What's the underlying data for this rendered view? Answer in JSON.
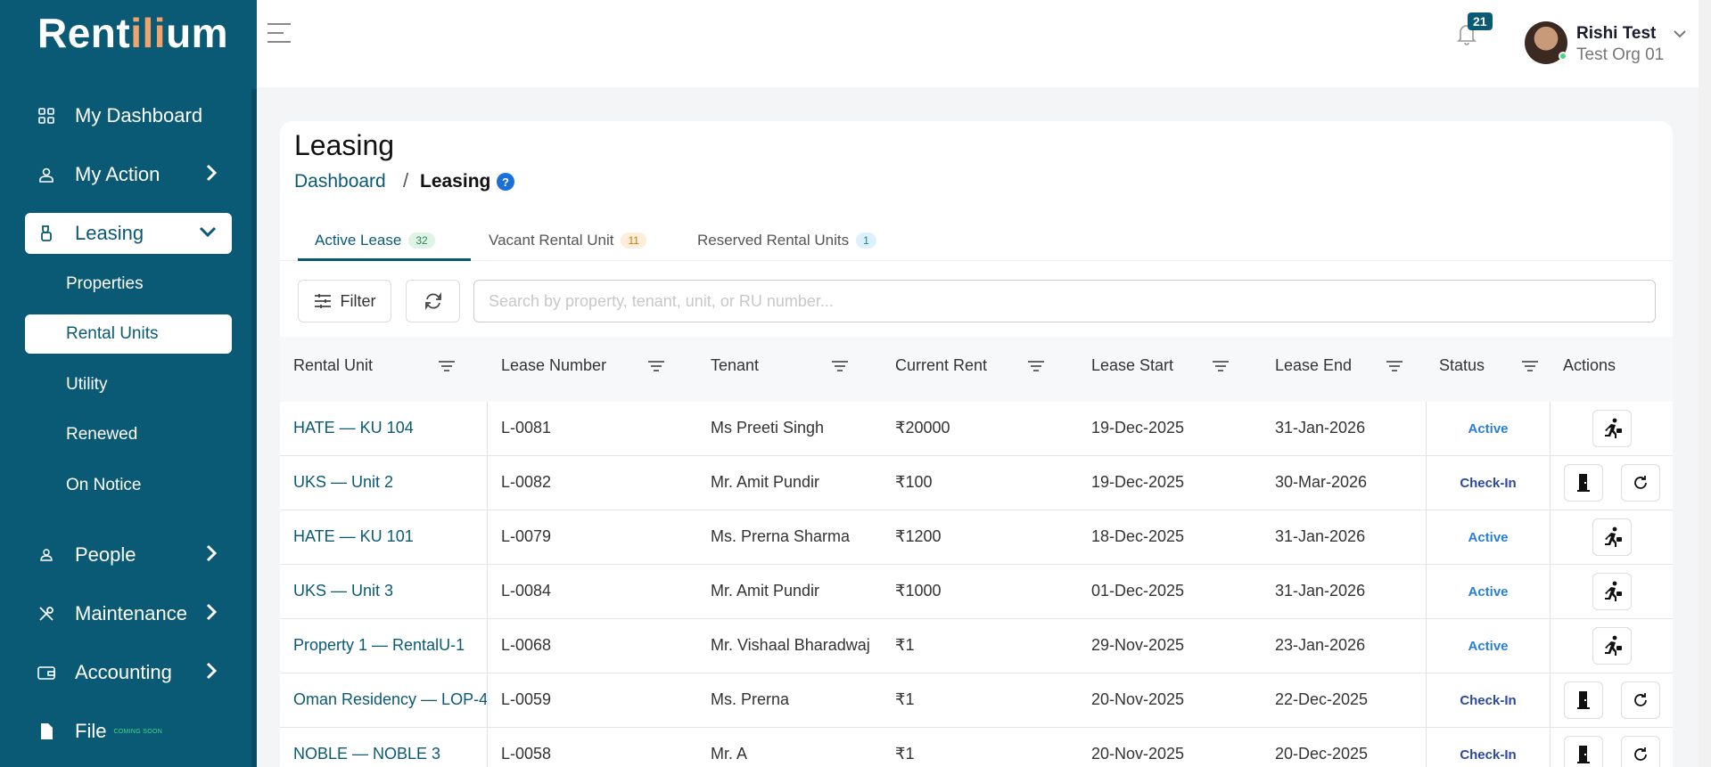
{
  "brand": {
    "logo_pre": "Rent",
    "logo_accent": "ili",
    "logo_post": "um"
  },
  "sidebar": {
    "items": [
      {
        "label": "My Dashboard",
        "icon": "grid-icon"
      },
      {
        "label": "My Action",
        "icon": "user-action-icon"
      },
      {
        "label": "Leasing",
        "icon": "lease-icon"
      },
      {
        "label": "People",
        "icon": "person-icon"
      },
      {
        "label": "Maintenance",
        "icon": "tools-icon"
      },
      {
        "label": "Accounting",
        "icon": "wallet-icon"
      },
      {
        "label": "File",
        "icon": "file-icon",
        "tag": "COMING SOON"
      }
    ],
    "leasing_sub": [
      "Properties",
      "Rental Units",
      "Utility",
      "Renewed",
      "On Notice"
    ]
  },
  "header": {
    "notifications": "21",
    "user_name": "Rishi Test",
    "user_org": "Test Org 01"
  },
  "page": {
    "title": "Leasing",
    "breadcrumb_root": "Dashboard",
    "breadcrumb_sep": "/",
    "breadcrumb_current": "Leasing",
    "help": "?"
  },
  "tabs": [
    {
      "label": "Active Lease",
      "count": "32",
      "badge_bg": "#dff3e6",
      "badge_fg": "#2b8a4f"
    },
    {
      "label": "Vacant Rental Unit",
      "count": "11",
      "badge_bg": "#fdeed9",
      "badge_fg": "#c9780c"
    },
    {
      "label": "Reserved Rental Units",
      "count": "1",
      "badge_bg": "#dcf1fb",
      "badge_fg": "#1d7fb0"
    }
  ],
  "toolbar": {
    "filter_label": "Filter",
    "search_placeholder": "Search by property, tenant, unit, or RU number..."
  },
  "table": {
    "columns": [
      "Rental Unit",
      "Lease Number",
      "Tenant",
      "Current Rent",
      "Lease Start",
      "Lease End",
      "Status",
      "Actions"
    ],
    "rows": [
      {
        "unit": "HATE — KU 104",
        "lease": "L-0081",
        "tenant": "Ms Preeti Singh",
        "rent": "₹20000",
        "start": "19-Dec-2025",
        "end": "31-Jan-2026",
        "status": "Active",
        "actions": [
          "move-out"
        ]
      },
      {
        "unit": "UKS — Unit 2",
        "lease": "L-0082",
        "tenant": "Mr. Amit Pundir",
        "rent": "₹100",
        "start": "19-Dec-2025",
        "end": "30-Mar-2026",
        "status": "Check-In",
        "actions": [
          "door",
          "refresh"
        ]
      },
      {
        "unit": "HATE — KU 101",
        "lease": "L-0079",
        "tenant": "Ms. Prerna Sharma",
        "rent": "₹1200",
        "start": "18-Dec-2025",
        "end": "31-Jan-2026",
        "status": "Active",
        "actions": [
          "move-out"
        ]
      },
      {
        "unit": "UKS — Unit 3",
        "lease": "L-0084",
        "tenant": "Mr. Amit Pundir",
        "rent": "₹1000",
        "start": "01-Dec-2025",
        "end": "31-Jan-2026",
        "status": "Active",
        "actions": [
          "move-out"
        ]
      },
      {
        "unit": "Property 1 — RentalU-1",
        "lease": "L-0068",
        "tenant": "Mr. Vishaal Bharadwaj",
        "rent": "₹1",
        "start": "29-Nov-2025",
        "end": "23-Jan-2026",
        "status": "Active",
        "actions": [
          "move-out"
        ]
      },
      {
        "unit": "Oman Residency — LOP-4",
        "lease": "L-0059",
        "tenant": "Ms. Prerna",
        "rent": "₹1",
        "start": "20-Nov-2025",
        "end": "22-Dec-2025",
        "status": "Check-In",
        "actions": [
          "door",
          "refresh"
        ]
      },
      {
        "unit": "NOBLE — NOBLE 3",
        "lease": "L-0058",
        "tenant": "Mr. A",
        "rent": "₹1",
        "start": "20-Nov-2025",
        "end": "20-Dec-2025",
        "status": "Check-In",
        "actions": [
          "door",
          "refresh"
        ]
      }
    ]
  },
  "colors": {
    "brand": "#0a5a75",
    "accent": "#f2a36b",
    "active": "#2a7fd4",
    "checkin": "#2c4a9c"
  }
}
